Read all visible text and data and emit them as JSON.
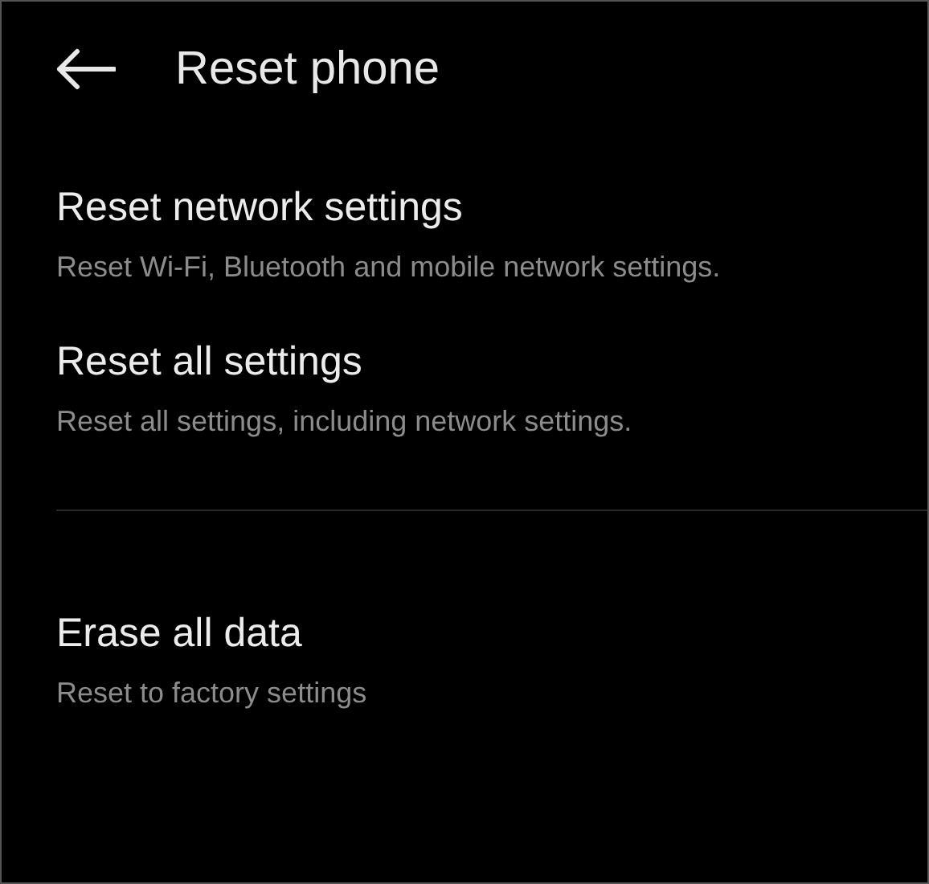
{
  "header": {
    "title": "Reset phone"
  },
  "groups": [
    {
      "items": [
        {
          "title": "Reset network settings",
          "subtitle": "Reset Wi-Fi, Bluetooth and mobile network settings."
        },
        {
          "title": "Reset all settings",
          "subtitle": "Reset all settings, including network settings."
        }
      ]
    },
    {
      "items": [
        {
          "title": "Erase all data",
          "subtitle": "Reset to factory settings"
        }
      ]
    }
  ]
}
